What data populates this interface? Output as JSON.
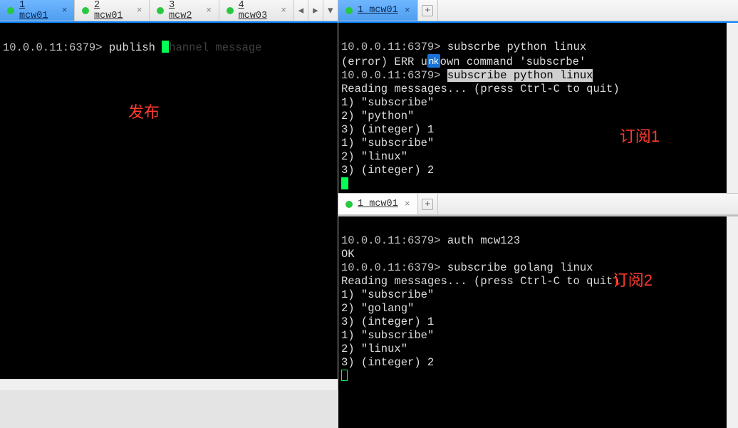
{
  "left": {
    "tabs": [
      {
        "index": "1",
        "label": "mcw01",
        "active": true
      },
      {
        "index": "2",
        "label": "mcw01",
        "active": false
      },
      {
        "index": "3",
        "label": "mcw2",
        "active": false
      },
      {
        "index": "4",
        "label": "mcw03",
        "active": false
      }
    ],
    "prompt": "10.0.0.11:6379>",
    "command_typed": "publish",
    "cursor_char": "c",
    "command_hint": "hannel message",
    "annotation": "发布"
  },
  "right_top": {
    "tab": {
      "index": "1",
      "label": "mcw01"
    },
    "lines": {
      "prompt": "10.0.0.11:6379>",
      "l1_cmd": "subscrbe python linux",
      "l2_pre": "(error) ERR u",
      "l2_ime": "nk",
      "l2_post": "own command 'subscrbe'",
      "l3_cmd_sel": "subscribe python linux",
      "l4": "Reading messages... (press Ctrl-C to quit)",
      "l5": "1) \"subscribe\"",
      "l6": "2) \"python\"",
      "l7": "3) (integer) 1",
      "l8": "1) \"subscribe\"",
      "l9": "2) \"linux\"",
      "l10": "3) (integer) 2"
    },
    "annotation": "订阅1"
  },
  "right_bottom": {
    "tab": {
      "index": "1",
      "label": "mcw01"
    },
    "lines": {
      "prompt": "10.0.0.11:6379>",
      "l1_cmd": "auth mcw123",
      "l2": "OK",
      "l3_cmd": "subscribe golang linux",
      "l4": "Reading messages... (press Ctrl-C to quit)",
      "l5": "1) \"subscribe\"",
      "l6": "2) \"golang\"",
      "l7": "3) (integer) 1",
      "l8": "1) \"subscribe\"",
      "l9": "2) \"linux\"",
      "l10": "3) (integer) 2"
    },
    "annotation": "订阅2"
  }
}
